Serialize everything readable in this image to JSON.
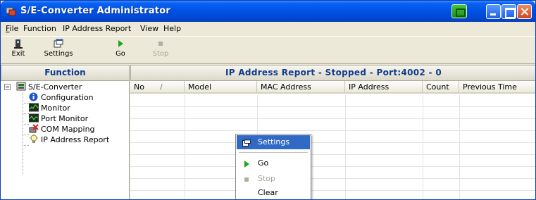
{
  "window": {
    "title": "S/E-Converter Administrator"
  },
  "menubar": {
    "items": [
      "File",
      "Function",
      "IP Address Report",
      "View",
      "Help"
    ],
    "mnemonics": [
      "F",
      "u",
      "I",
      "V",
      "H"
    ]
  },
  "toolbar": {
    "exit_label": "Exit",
    "settings_label": "Settings",
    "go_label": "Go",
    "stop_label": "Stop",
    "stop_disabled": true
  },
  "left_pane": {
    "header": "Function",
    "tree": {
      "root": "S/E-Converter",
      "children": [
        "Configuration",
        "Monitor",
        "Port Monitor",
        "COM Mapping",
        "IP Address Report"
      ]
    }
  },
  "right_pane": {
    "header": "IP Address Report - Stopped - Port:4002 - 0",
    "columns": [
      "No",
      "/",
      "Model",
      "MAC Address",
      "IP Address",
      "Count",
      "Previous Time"
    ],
    "rows": []
  },
  "context_menu": {
    "items": [
      {
        "label": "Settings",
        "highlighted": true,
        "icon": "settings-icon"
      },
      {
        "label": "Go",
        "icon": "go-arrow-icon"
      },
      {
        "label": "Stop",
        "disabled": true,
        "icon": "stop-square-icon"
      },
      {
        "label": "Clear"
      }
    ]
  },
  "colors": {
    "title_bar": "#0053e6",
    "pane_header_text": "#113c8c",
    "highlight": "#316ac5",
    "go_green": "#1ea51a"
  }
}
